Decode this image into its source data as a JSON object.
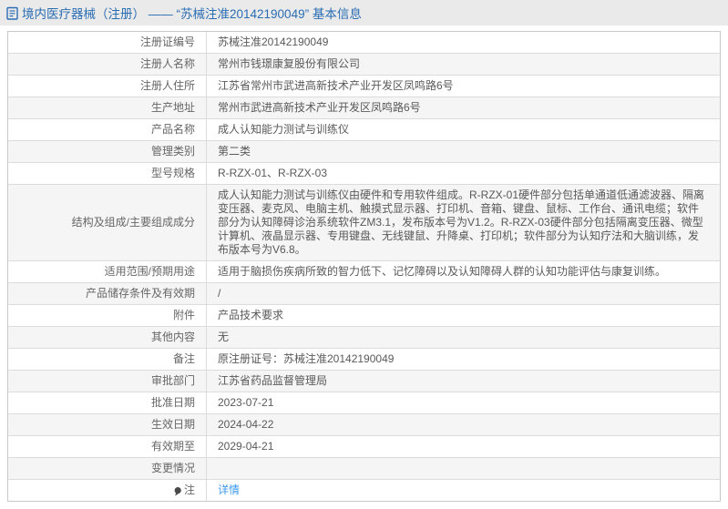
{
  "header": {
    "icon": "document-icon",
    "title": "境内医疗器械（注册） —— “苏械注准20142190049” 基本信息"
  },
  "colors": {
    "titlebar_bg": "#eaeaea",
    "title_text": "#2a6db3",
    "link": "#3d9af0",
    "row_alt_bg": "#f5f5f5",
    "border": "#c9c9c9",
    "cell_text": "#666666"
  },
  "table": {
    "rows": [
      {
        "label": "注册证编号",
        "value": "苏械注准20142190049"
      },
      {
        "label": "注册人名称",
        "value": "常州市钱璟康复股份有限公司"
      },
      {
        "label": "注册人住所",
        "value": "江苏省常州市武进高新技术产业开发区凤鸣路6号"
      },
      {
        "label": "生产地址",
        "value": "常州市武进高新技术产业开发区凤鸣路6号"
      },
      {
        "label": "产品名称",
        "value": "成人认知能力测试与训练仪"
      },
      {
        "label": "管理类别",
        "value": "第二类"
      },
      {
        "label": "型号规格",
        "value": "R-RZX-01、R-RZX-03"
      },
      {
        "label": "结构及组成/主要组成成分",
        "value": "成人认知能力测试与训练仪由硬件和专用软件组成。R-RZX-01硬件部分包括单通道低通滤波器、隔离变压器、麦克风、电脑主机、触摸式显示器、打印机、音箱、键盘、鼠标、工作台、通讯电缆；软件部分为认知障碍诊治系统软件ZM3.1，发布版本号为V1.2。R-RZX-03硬件部分包括隔离变压器、微型计算机、液晶显示器、专用键盘、无线键鼠、升降桌、打印机；软件部分为认知疗法和大脑训练，发布版本号为V6.8。"
      },
      {
        "label": "适用范围/预期用途",
        "value": "适用于脑损伤疾病所致的智力低下、记忆障碍以及认知障碍人群的认知功能评估与康复训练。"
      },
      {
        "label": "产品储存条件及有效期",
        "value": "/"
      },
      {
        "label": "附件",
        "value": "产品技术要求"
      },
      {
        "label": "其他内容",
        "value": "无"
      },
      {
        "label": "备注",
        "value": "原注册证号：苏械注准20142190049"
      },
      {
        "label": "审批部门",
        "value": "江苏省药品监督管理局"
      },
      {
        "label": "批准日期",
        "value": "2023-07-21"
      },
      {
        "label": "生效日期",
        "value": "2024-04-22"
      },
      {
        "label": "有效期至",
        "value": "2029-04-21"
      },
      {
        "label": "变更情况",
        "value": ""
      },
      {
        "label": "注",
        "value": "详情"
      }
    ]
  }
}
